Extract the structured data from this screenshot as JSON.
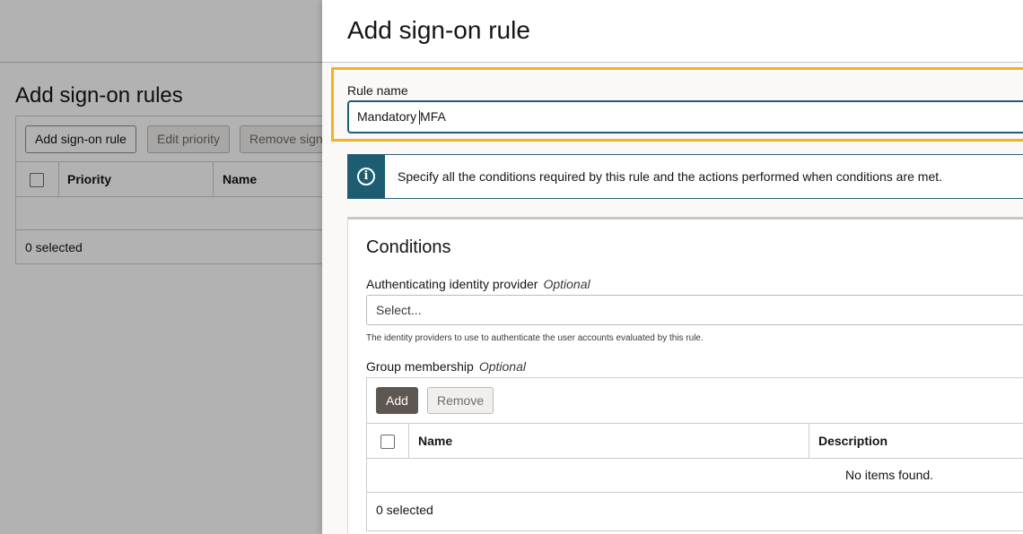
{
  "background": {
    "title": "Add sign-on rules",
    "toolbar": {
      "add_label": "Add sign-on rule",
      "edit_priority_label": "Edit priority",
      "remove_label": "Remove sign"
    },
    "table": {
      "col_priority": "Priority",
      "col_name": "Name",
      "footer": "0 selected"
    }
  },
  "drawer": {
    "title": "Add sign-on rule",
    "rule_name": {
      "label": "Rule name",
      "value_before_cursor": "Mandatory ",
      "value_after_cursor": "MFA"
    },
    "info": {
      "icon": "info-icon",
      "text": "Specify all the conditions required by this rule and the actions performed when conditions are met."
    },
    "conditions": {
      "title": "Conditions",
      "idp": {
        "label": "Authenticating identity provider",
        "optional": "Optional",
        "placeholder": "Select...",
        "help": "The identity providers to use to authenticate the user accounts evaluated by this rule."
      },
      "group": {
        "label": "Group membership",
        "optional": "Optional",
        "add_label": "Add",
        "remove_label": "Remove",
        "col_name": "Name",
        "col_description": "Description",
        "empty": "No items found.",
        "footer": "0 selected"
      }
    }
  },
  "colors": {
    "highlight": "#f0b323",
    "info_accent": "#1d5d71",
    "button_dark": "#5c5753"
  }
}
